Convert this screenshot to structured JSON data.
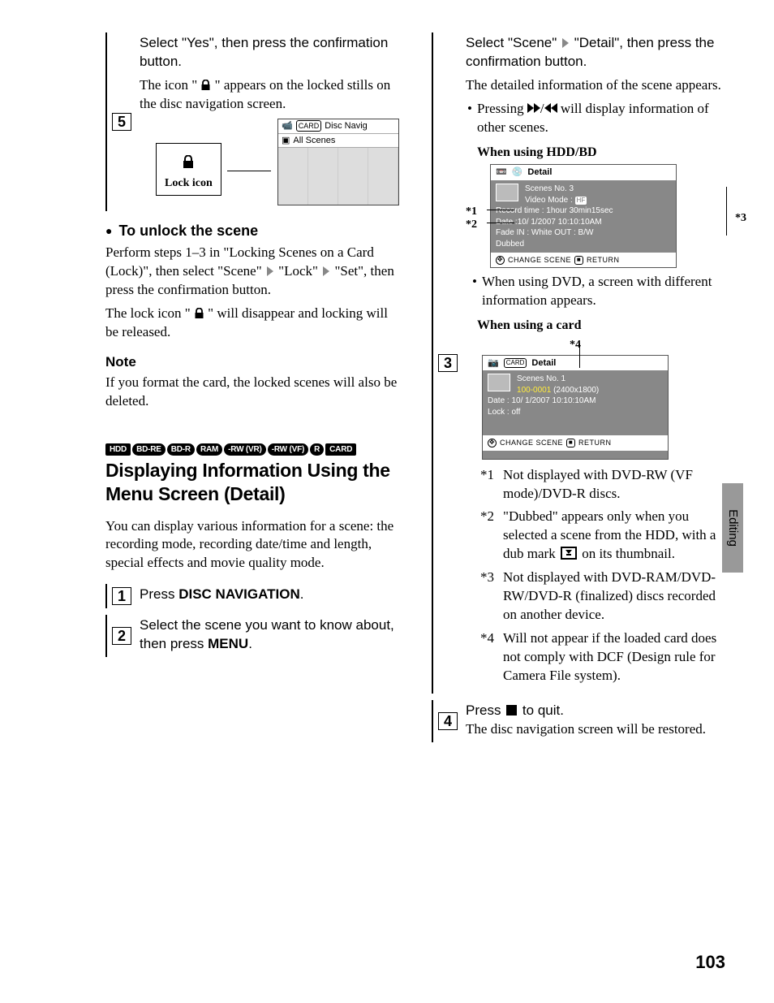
{
  "pageNumber": "103",
  "sideTab": "Editing",
  "left": {
    "step5": {
      "num": "5",
      "boldLine": "Select \"Yes\", then press the confirmation button.",
      "para": "The icon \" 🔒 \" appears on the locked stills on the disc navigation screen.",
      "lockLabel": "Lock icon",
      "navTop": "Disc Navig",
      "navRow2": "All Scenes"
    },
    "unlock": {
      "heading": "To unlock the scene",
      "p1a": "Perform steps 1–3 in \"Locking Scenes on a Card (Lock)\", then select \"Scene\"",
      "p1b": "\"Lock\"",
      "p1c": "\"Set\", then press the confirmation button.",
      "p2": "The lock icon \" 🔒 \" will disappear and locking will be released."
    },
    "note": {
      "heading": "Note",
      "body": "If you format the card, the locked scenes will also be deleted."
    },
    "badges": [
      "HDD",
      "BD-RE",
      "BD-R",
      "RAM",
      "-RW (VR)",
      "-RW (VF)",
      "R",
      "CARD"
    ],
    "title": "Displaying Information Using the Menu Screen (Detail)",
    "intro": "You can display various information for a scene: the recording mode, recording date/time and length, special effects and movie quality mode.",
    "step1": {
      "num": "1",
      "text": "Press ",
      "bold": "DISC NAVIGATION",
      "tail": "."
    },
    "step2": {
      "num": "2",
      "text": "Select the scene you want to know about, then press ",
      "bold": "MENU",
      "tail": "."
    }
  },
  "right": {
    "step3": {
      "num": "3",
      "boldA": "Select \"Scene\"",
      "boldB": "\"Detail\", then press the confirmation button.",
      "para1": "The detailed information of the scene appears.",
      "bullet": "Pressing ",
      "bulletTail": " will display information of other scenes.",
      "sub1": "When using HDD/BD",
      "screen1": {
        "title": "Detail",
        "l1": "Scenes No. 3",
        "l2": "Video Mode : ",
        "badge": "HF",
        "l3": "Record time : 1hour 30min15sec",
        "l4": "Date :10/ 1/2007 10:10:10AM",
        "l5": "Fade IN : White OUT : B/W",
        "l6": "Dubbed",
        "foot": "CHANGE SCENE",
        "foot2": "RETURN"
      },
      "a1": "*1",
      "a2": "*2",
      "a3": "*3",
      "a4": "*4",
      "afterScreen1": "When using DVD, a screen with different information appears.",
      "sub2": "When using a card",
      "screen2": {
        "title": "Detail",
        "l1": "Scenes No. 1",
        "l2": "100-0001",
        "l2b": "(2400x1800)",
        "l3": "Date : 10/ 1/2007 10:10:10AM",
        "l4": "Lock : off",
        "foot": "CHANGE SCENE",
        "foot2": "RETURN"
      },
      "notes": [
        {
          "k": "*1",
          "t": "Not displayed with DVD-RW (VF mode)/DVD-R discs."
        },
        {
          "k": "*2",
          "t": "\"Dubbed\" appears only when you selected a scene from the HDD, with a dub mark ",
          "tail": " on its thumbnail."
        },
        {
          "k": "*3",
          "t": "Not displayed with DVD-RAM/DVD-RW/DVD-R (finalized) discs recorded on another device."
        },
        {
          "k": "*4",
          "t": "Will not appear if the loaded card does not comply with DCF (Design rule for Camera File system)."
        }
      ]
    },
    "step4": {
      "num": "4",
      "bold": "Press ",
      "boldTail": " to quit.",
      "body": "The disc navigation screen will be restored."
    }
  }
}
